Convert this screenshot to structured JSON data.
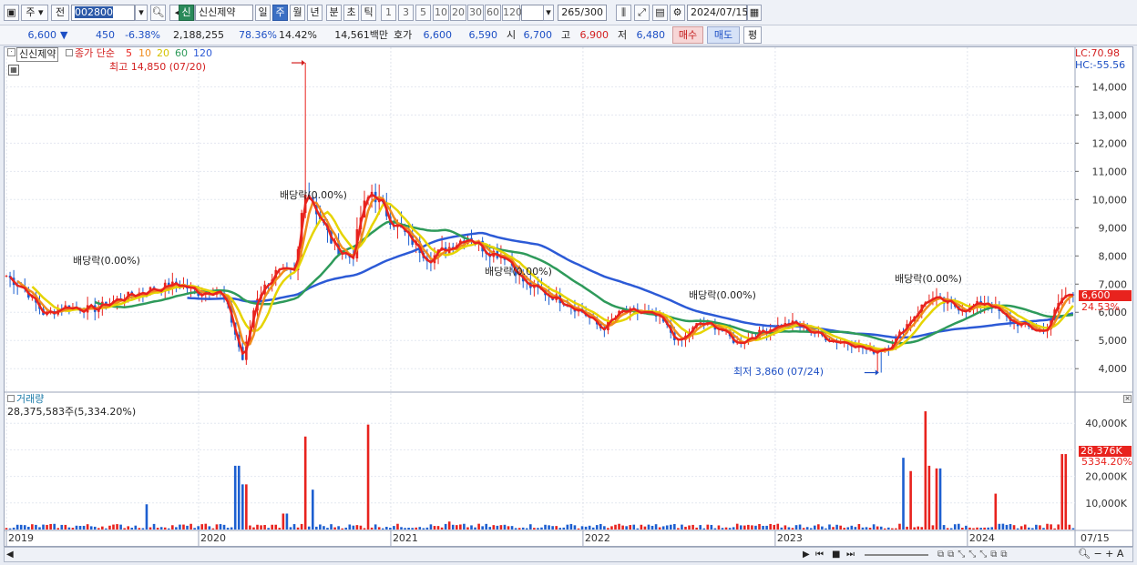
{
  "toolbar": {
    "type_label": "주",
    "prev_label": "전",
    "code": "002800",
    "sin_badge": "신",
    "stock_name": "신신제약",
    "periods": [
      "일",
      "주",
      "월",
      "년",
      "분",
      "초",
      "틱"
    ],
    "selected_period": "주",
    "numbers": [
      "1",
      "3",
      "5",
      "10",
      "20",
      "30",
      "60",
      "120"
    ],
    "count": "265",
    "count_total": "/300",
    "date": "2024/07/15"
  },
  "quote": {
    "price": "6,600",
    "arrow": "▼",
    "change": "450",
    "change_pct": "-6.38%",
    "volume": "2,188,255",
    "ratio": "78.36%",
    "turnover": "14.42%",
    "amount": "14,561백만",
    "hoga_label": "호가",
    "ask": "6,600",
    "bid": "6,590",
    "open_label": "시",
    "open": "6,700",
    "high_label": "고",
    "high": "6,900",
    "low_label": "저",
    "low": "6,480",
    "buy_label": "매수",
    "sell_label": "매도",
    "eval_label": "평"
  },
  "legend": {
    "name": "신신제약",
    "series_title": "종가 단순",
    "ma": [
      {
        "label": "5",
        "color": "#e8231e"
      },
      {
        "label": "10",
        "color": "#f08c1e"
      },
      {
        "label": "20",
        "color": "#e6d400"
      },
      {
        "label": "60",
        "color": "#2e9a5a"
      },
      {
        "label": "120",
        "color": "#2c5ad6"
      }
    ],
    "lc": "LC:70.98",
    "hc": "HC:-55.56"
  },
  "annotations": {
    "high": "최고 14,850 (07/20)",
    "low": "최저 3,860 (07/24)",
    "dividend": "배당락(0.00%)"
  },
  "price_tag": {
    "value": "6,600",
    "pct": "24.53%"
  },
  "volume_panel": {
    "title": "거래량",
    "value": "28,375,583주(5,334.20%)",
    "tag_value": "28,376K",
    "tag_pct": "5334.20%"
  },
  "chart_data": {
    "type": "candlestick",
    "price_axis": {
      "ticks": [
        "14,000",
        "13,000",
        "12,000",
        "11,000",
        "10,000",
        "9,000",
        "8,000",
        "7,000",
        "6,000",
        "5,000",
        "4,000"
      ]
    },
    "volume_axis": {
      "ticks": [
        "40,000K",
        "30,000K",
        "20,000K",
        "10,000K"
      ]
    },
    "x_labels": [
      "2019",
      "2020",
      "2021",
      "2022",
      "2023",
      "2024",
      "07/15"
    ],
    "price_key": [
      [
        2019.0,
        7300
      ],
      [
        2019.1,
        6800
      ],
      [
        2019.2,
        5900
      ],
      [
        2019.3,
        6200
      ],
      [
        2019.45,
        6100
      ],
      [
        2019.6,
        6500
      ],
      [
        2019.75,
        6800
      ],
      [
        2019.9,
        7000
      ],
      [
        2020.0,
        6700
      ],
      [
        2020.1,
        6800
      ],
      [
        2020.15,
        6200
      ],
      [
        2020.2,
        5000
      ],
      [
        2020.23,
        4300
      ],
      [
        2020.3,
        6500
      ],
      [
        2020.4,
        7400
      ],
      [
        2020.5,
        7400
      ],
      [
        2020.5,
        7500
      ],
      [
        2020.52,
        8300
      ],
      [
        2020.55,
        10500
      ],
      [
        2020.6,
        9800
      ],
      [
        2020.7,
        8400
      ],
      [
        2020.8,
        7900
      ],
      [
        2020.85,
        9600
      ],
      [
        2020.9,
        10300
      ],
      [
        2021.0,
        9300
      ],
      [
        2021.1,
        8600
      ],
      [
        2021.2,
        7900
      ],
      [
        2021.3,
        8300
      ],
      [
        2021.4,
        8700
      ],
      [
        2021.5,
        8200
      ],
      [
        2021.6,
        8000
      ],
      [
        2021.7,
        7000
      ],
      [
        2021.8,
        6700
      ],
      [
        2021.9,
        6400
      ],
      [
        2022.0,
        6000
      ],
      [
        2022.1,
        5400
      ],
      [
        2022.2,
        6000
      ],
      [
        2022.3,
        6000
      ],
      [
        2022.4,
        5800
      ],
      [
        2022.5,
        4900
      ],
      [
        2022.6,
        5600
      ],
      [
        2022.7,
        5500
      ],
      [
        2022.8,
        4900
      ],
      [
        2022.9,
        5200
      ],
      [
        2023.0,
        5500
      ],
      [
        2023.1,
        5600
      ],
      [
        2023.2,
        5300
      ],
      [
        2023.3,
        5000
      ],
      [
        2023.4,
        4900
      ],
      [
        2023.5,
        4600
      ],
      [
        2023.6,
        4800
      ],
      [
        2023.7,
        5700
      ],
      [
        2023.8,
        6500
      ],
      [
        2023.9,
        6300
      ],
      [
        2024.0,
        6100
      ],
      [
        2024.1,
        6400
      ],
      [
        2024.2,
        5800
      ],
      [
        2024.3,
        5500
      ],
      [
        2024.4,
        5300
      ],
      [
        2024.5,
        6600
      ]
    ],
    "volume_spikes_k": [
      [
        2019.73,
        9500
      ],
      [
        2020.2,
        24000
      ],
      [
        2020.24,
        17000
      ],
      [
        2020.45,
        6000
      ],
      [
        2020.55,
        35000
      ],
      [
        2020.6,
        15000
      ],
      [
        2020.88,
        39500
      ],
      [
        2021.3,
        3000
      ],
      [
        2023.67,
        27000
      ],
      [
        2023.7,
        22000
      ],
      [
        2023.78,
        44500
      ],
      [
        2023.8,
        24000
      ],
      [
        2023.85,
        23000
      ],
      [
        2024.15,
        13500
      ],
      [
        2024.5,
        28400
      ]
    ],
    "ma_values": {
      "ma5": "red",
      "ma10": "orange",
      "ma20": "yellow",
      "ma60": "green",
      "ma120": "blue"
    }
  }
}
